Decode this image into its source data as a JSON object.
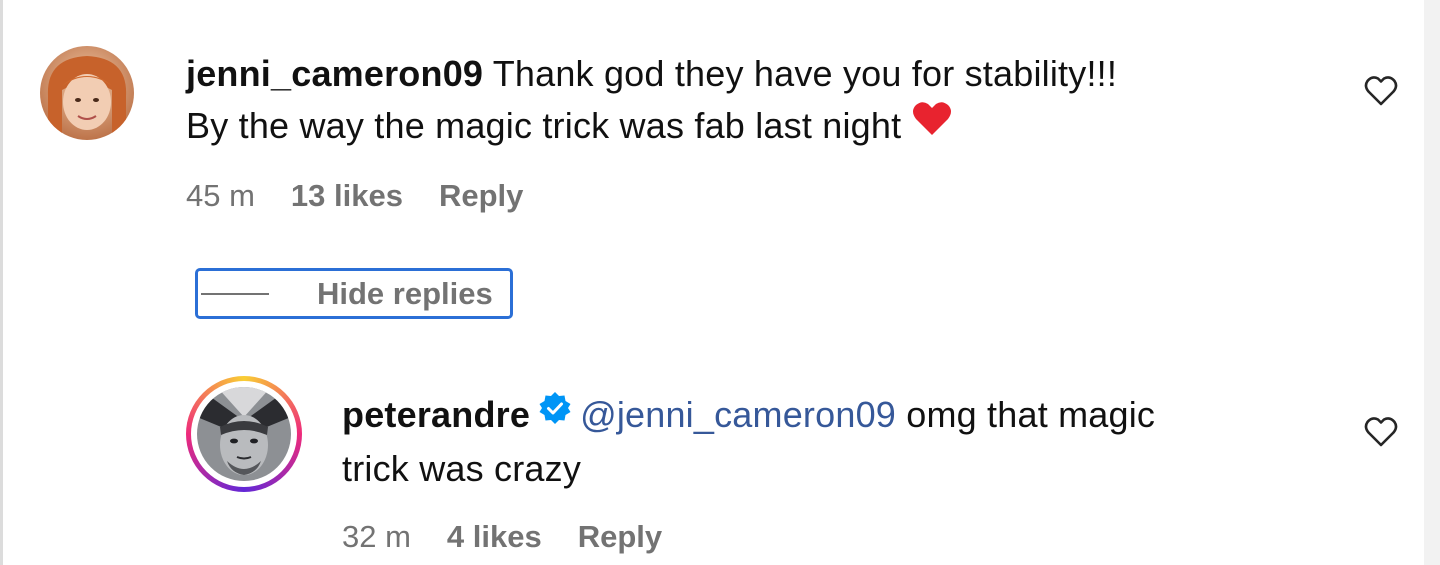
{
  "comments": [
    {
      "username": "jenni_cameron09",
      "text_line1": "Thank god they have you for stability!!!",
      "text_line2": "By the way the magic trick was fab last night",
      "emoji": "❤️",
      "time": "45 m",
      "likes": "13 likes",
      "reply_label": "Reply",
      "avatar": "avatar-jenni"
    }
  ],
  "thread": {
    "toggle_label": "Hide replies"
  },
  "replies": [
    {
      "username": "peterandre",
      "verified": true,
      "mention": "@jenni_cameron09",
      "text_line1": "omg that magic",
      "text_line2": "trick was crazy",
      "time": "32 m",
      "likes": "4 likes",
      "reply_label": "Reply",
      "avatar": "avatar-peterandre"
    }
  ],
  "icons": {
    "like": "heart-outline-icon",
    "verified": "verified-badge-icon"
  },
  "colors": {
    "mention": "#365899",
    "meta": "#737373",
    "verified": "#0095f6",
    "focus_ring": "#2b6fd6",
    "emoji_heart": "#e8232f"
  }
}
